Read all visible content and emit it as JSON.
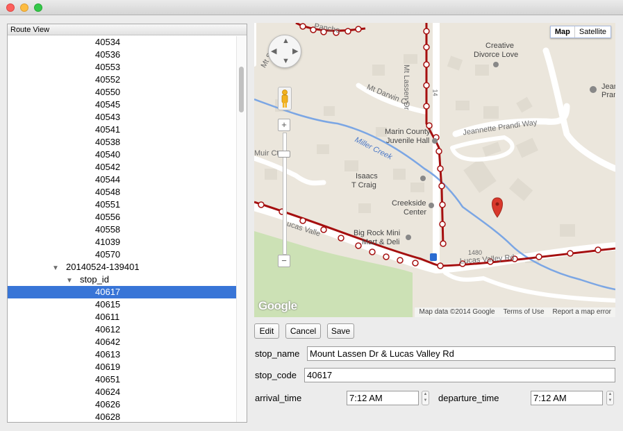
{
  "tree": {
    "header": "Route View",
    "rows": [
      {
        "text": "40534",
        "indent": 2
      },
      {
        "text": "40536",
        "indent": 2
      },
      {
        "text": "40553",
        "indent": 2
      },
      {
        "text": "40552",
        "indent": 2
      },
      {
        "text": "40550",
        "indent": 2
      },
      {
        "text": "40545",
        "indent": 2
      },
      {
        "text": "40543",
        "indent": 2
      },
      {
        "text": "40541",
        "indent": 2
      },
      {
        "text": "40538",
        "indent": 2
      },
      {
        "text": "40540",
        "indent": 2
      },
      {
        "text": "40542",
        "indent": 2
      },
      {
        "text": "40544",
        "indent": 2
      },
      {
        "text": "40548",
        "indent": 2
      },
      {
        "text": "40551",
        "indent": 2
      },
      {
        "text": "40556",
        "indent": 2
      },
      {
        "text": "40558",
        "indent": 2
      },
      {
        "text": "41039",
        "indent": 2
      },
      {
        "text": "40570",
        "indent": 2
      },
      {
        "text": "20140524-139401",
        "indent": 0,
        "expanded": true
      },
      {
        "text": "stop_id",
        "indent": 1,
        "expanded": true
      },
      {
        "text": "40617",
        "indent": 2,
        "selected": true
      },
      {
        "text": "40615",
        "indent": 2
      },
      {
        "text": "40611",
        "indent": 2
      },
      {
        "text": "40612",
        "indent": 2
      },
      {
        "text": "40642",
        "indent": 2
      },
      {
        "text": "40613",
        "indent": 2
      },
      {
        "text": "40619",
        "indent": 2
      },
      {
        "text": "40651",
        "indent": 2
      },
      {
        "text": "40624",
        "indent": 2
      },
      {
        "text": "40626",
        "indent": 2
      },
      {
        "text": "40628",
        "indent": 2
      }
    ]
  },
  "map": {
    "map_type_map": "Map",
    "map_type_satellite": "Satellite",
    "logo": "Google",
    "attribution": "Map data ©2014 Google",
    "terms": "Terms of Use",
    "report": "Report a map error",
    "zoom_in": "+",
    "zoom_out": "−",
    "labels": {
      "creative": "Creative",
      "divorce": "Divorce Love",
      "jean": "Jean",
      "pran": "Pran",
      "darwin": "Mt Darwin Ct",
      "marin1": "Marin County",
      "marin2": "Juvenile Hall",
      "prandi": "Jeannette Prandi Way",
      "miller": "Miller Creek",
      "isaacs1": "Isaacs",
      "isaacs2": "T Craig",
      "creekside1": "Creekside",
      "creekside2": "Center",
      "bigrock1": "Big Rock Mini",
      "bigrock2": "Mart & Deli",
      "muir": "Muir Ct",
      "lucas": "Lucas Valley Rd",
      "lucas_left": "Lucas Valle",
      "num1480": "1480",
      "lassen": "Mt Lassen Dr",
      "num14": "14",
      "susanna": "Mt Susana",
      "pancho": "Pancho"
    },
    "colors": {
      "route": "#a50f0f",
      "water": "#7ba6e4",
      "park": "#cce1b5",
      "road": "#ffffff",
      "marker": "#d9382c"
    }
  },
  "toolbar": {
    "edit": "Edit",
    "cancel": "Cancel",
    "save": "Save"
  },
  "form": {
    "stop_name_label": "stop_name",
    "stop_name_value": "Mount Lassen Dr & Lucas Valley Rd",
    "stop_code_label": "stop_code",
    "stop_code_value": "40617",
    "arrival_label": "arrival_time",
    "arrival_value": "7:12 AM",
    "departure_label": "departure_time",
    "departure_value": "7:12 AM"
  }
}
